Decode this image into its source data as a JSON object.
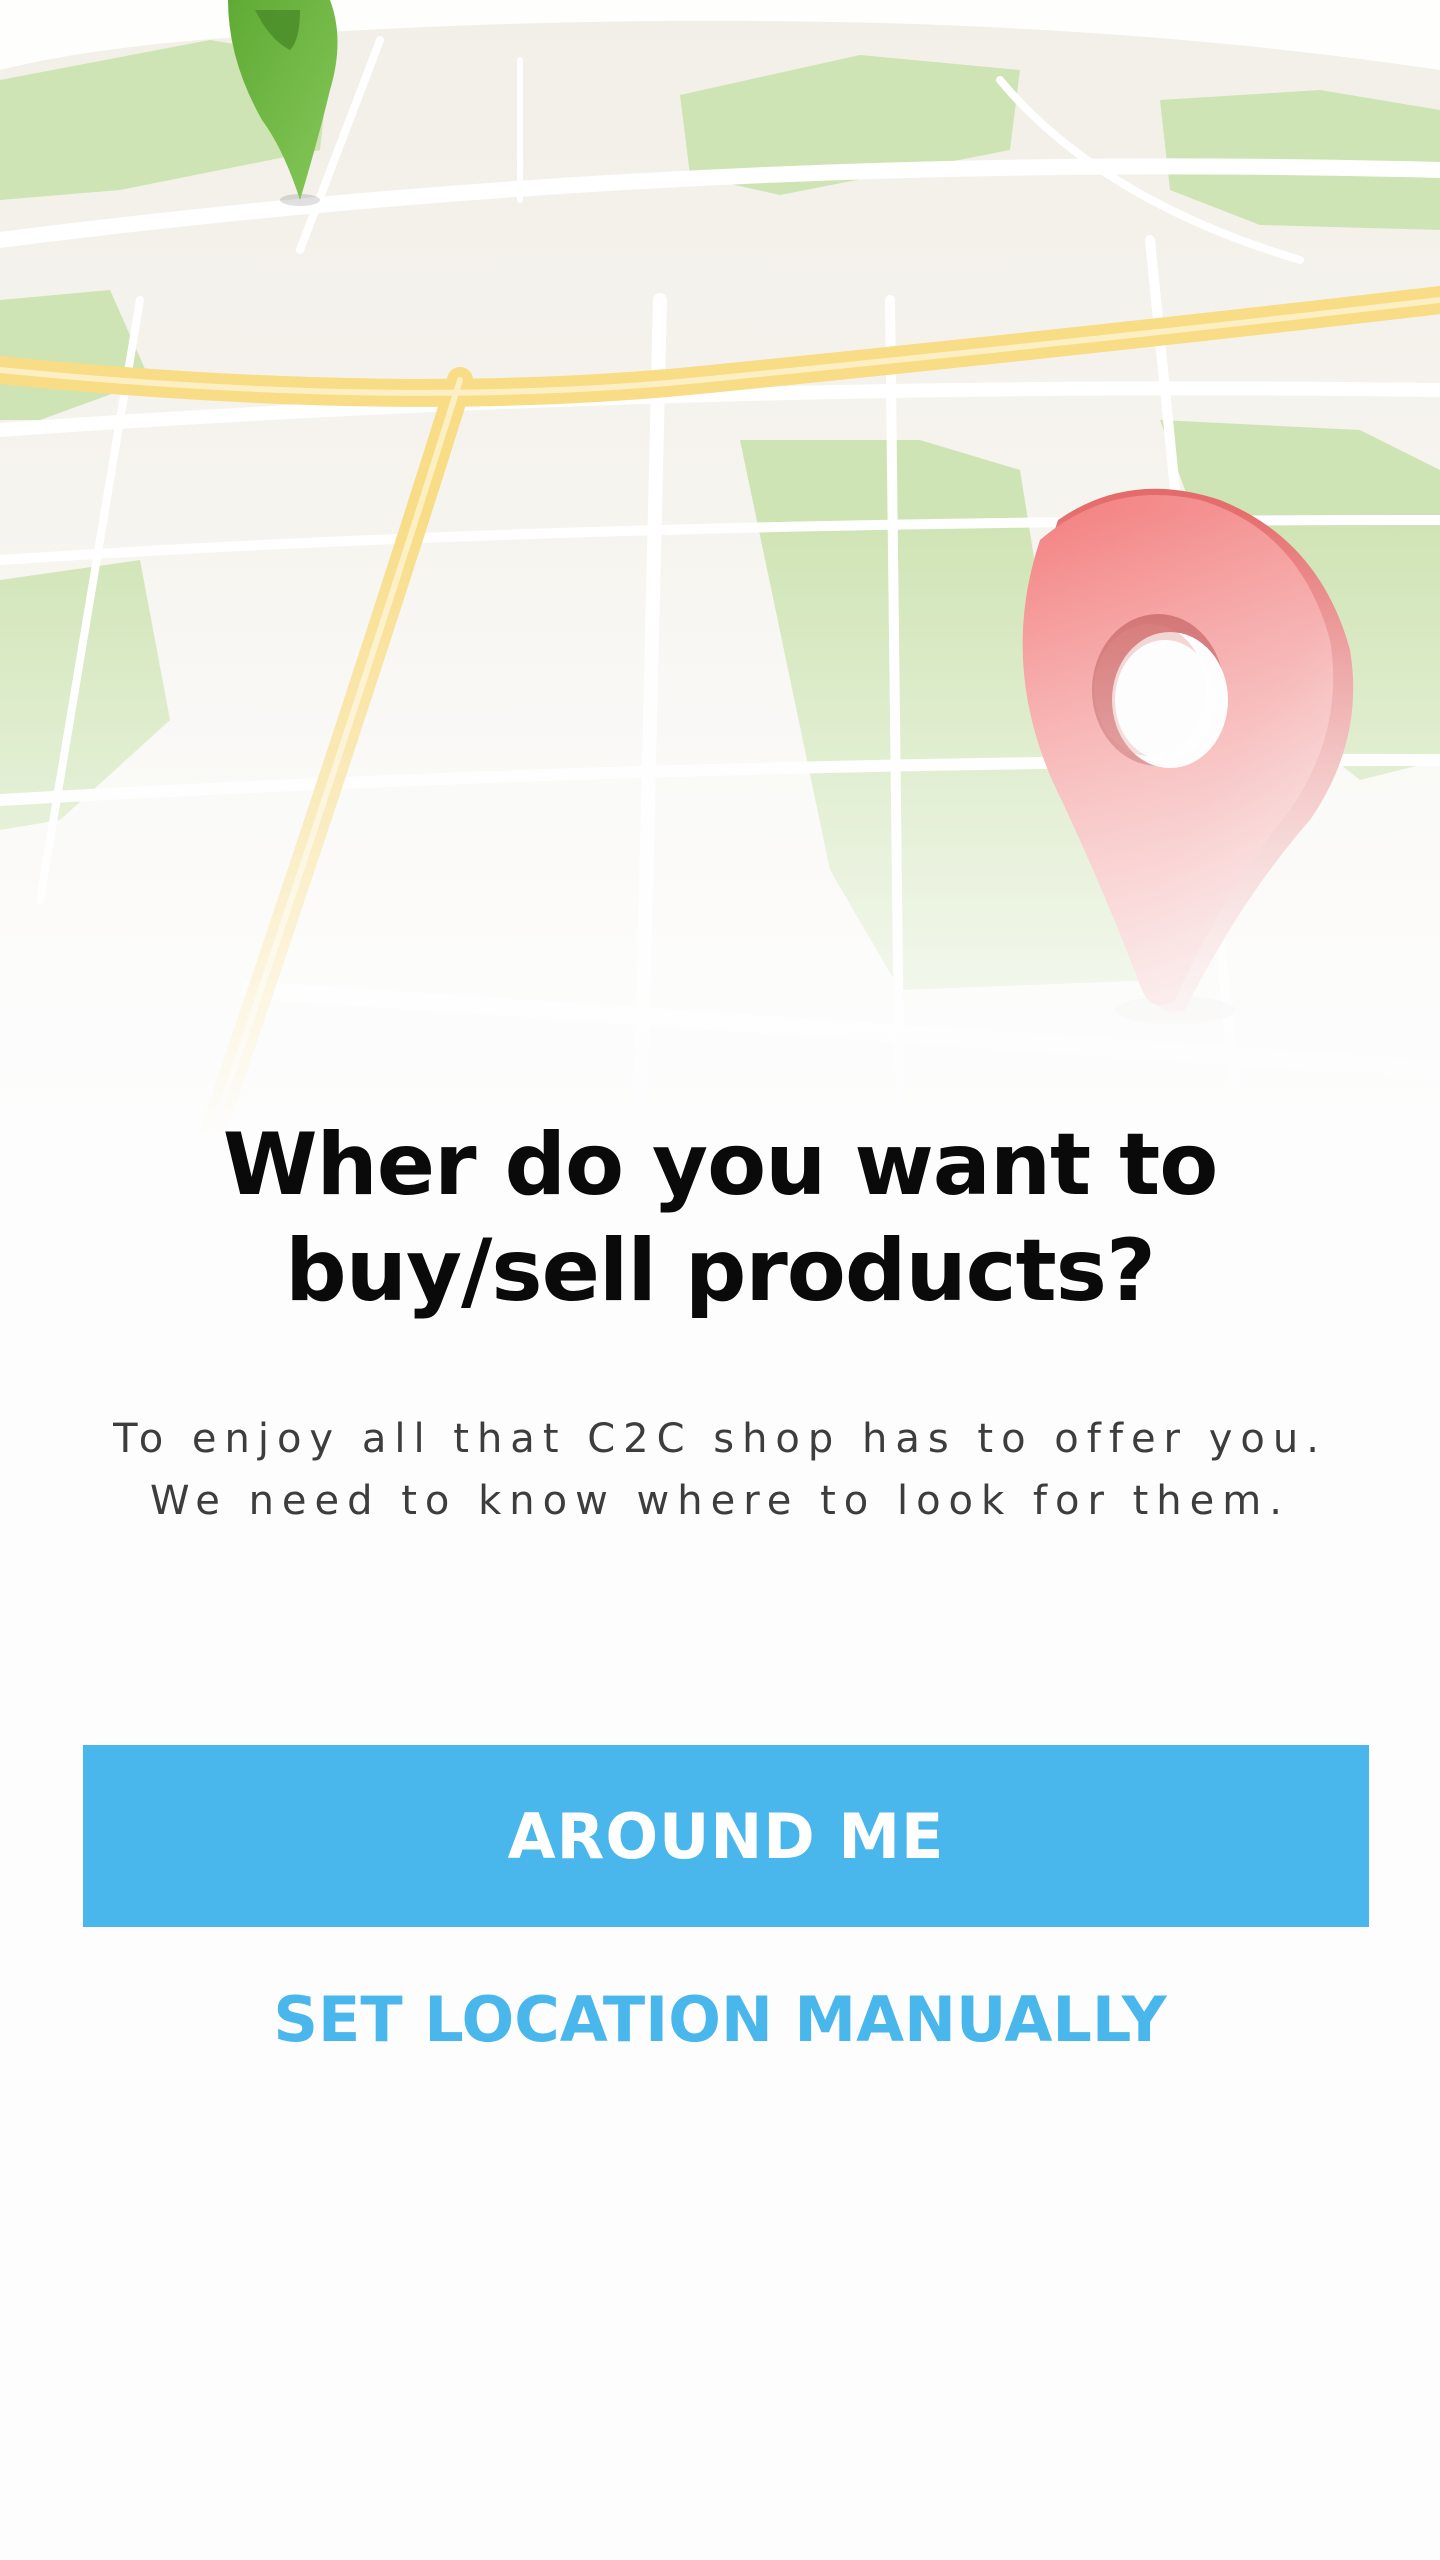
{
  "hero": {
    "image_description": "map-illustration",
    "pins": [
      {
        "icon": "map-pin-icon",
        "color": "#6ab83f"
      },
      {
        "icon": "map-pin-icon",
        "color": "#f17c7c"
      }
    ]
  },
  "headline": {
    "line1": "Wher do you want to",
    "line2": "buy/sell products?"
  },
  "subtitle": {
    "line1": "To enjoy all that C2C shop has to offer you.",
    "line2": "We need to know where to look for them."
  },
  "actions": {
    "primary_label": "AROUND ME",
    "secondary_label": "SET LOCATION MANUALLY"
  },
  "colors": {
    "accent": "#49b6ec",
    "background": "#fdfdfd",
    "headline": "#0a0a0a",
    "body_text": "#3d3d3d"
  }
}
